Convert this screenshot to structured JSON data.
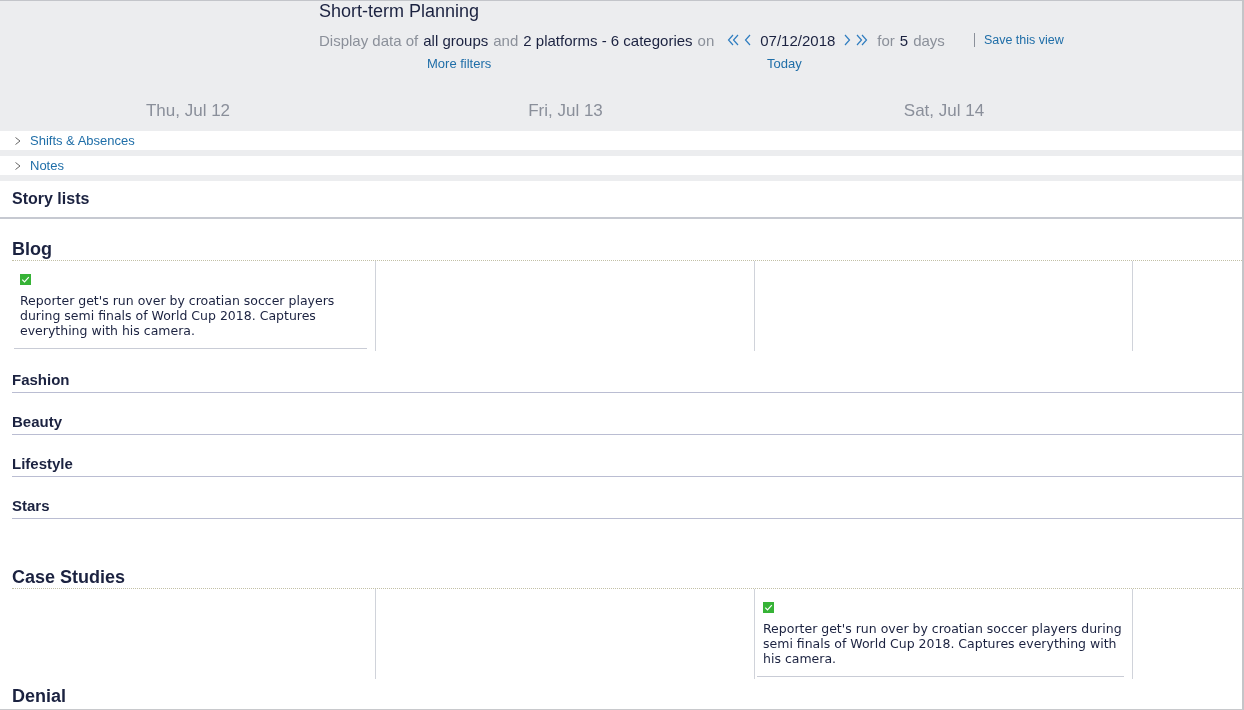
{
  "header": {
    "title": "Short-term Planning",
    "filter": {
      "segments": [
        {
          "kind": "label",
          "text": "Display data of"
        },
        {
          "kind": "value",
          "text": "all groups"
        },
        {
          "kind": "label",
          "text": "and"
        },
        {
          "kind": "value",
          "text": "2 platforms - 6 categories"
        },
        {
          "kind": "label",
          "text": "on"
        },
        {
          "kind": "date",
          "text": "07/12/2018"
        },
        {
          "kind": "label",
          "text": "for"
        },
        {
          "kind": "value",
          "text": "5"
        },
        {
          "kind": "label",
          "text": "days"
        }
      ],
      "save_link": "Save this view",
      "more_filters_link": "More filters",
      "today_link": "Today"
    }
  },
  "days": [
    {
      "label": "Thu, Jul 12"
    },
    {
      "label": "Fri, Jul 13"
    },
    {
      "label": "Sat, Jul 14"
    }
  ],
  "sections": [
    {
      "label": "Shifts & Absences",
      "expanded": false
    },
    {
      "label": "Notes",
      "expanded": false
    }
  ],
  "story_lists": {
    "title": "Story lists",
    "categories": [
      {
        "name": "Blog",
        "kind": "board",
        "cells": [
          {
            "kind": "story",
            "text": "Reporter get's run over by croatian soccer players during semi finals of World Cup 2018. Captures everything with his camera.",
            "done": true
          },
          {
            "kind": "empty"
          },
          {
            "kind": "empty"
          },
          {
            "kind": "empty"
          }
        ]
      },
      {
        "name": "Fashion",
        "kind": "compact"
      },
      {
        "name": "Beauty",
        "kind": "compact"
      },
      {
        "name": "Lifestyle",
        "kind": "compact"
      },
      {
        "name": "Stars",
        "kind": "compact"
      },
      {
        "name": "Case Studies",
        "kind": "board",
        "cells": [
          {
            "kind": "empty"
          },
          {
            "kind": "empty"
          },
          {
            "kind": "story",
            "text": "Reporter get's run over by croatian soccer players during semi finals of World Cup 2018. Captures everything with his camera.",
            "done": true
          },
          {
            "kind": "empty"
          }
        ]
      },
      {
        "name": "Denial",
        "kind": "board"
      }
    ]
  }
}
